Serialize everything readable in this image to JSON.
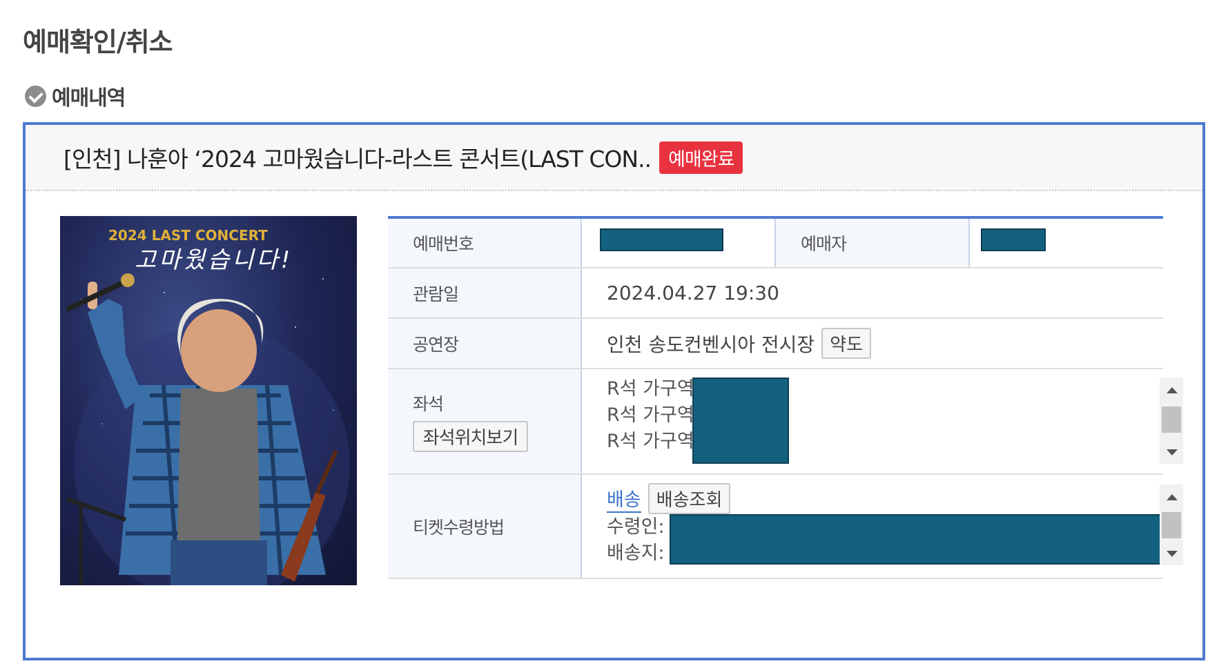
{
  "page_title": "예매확인/취소",
  "section_label": "예매내역",
  "booking": {
    "event_title": "[인천] 나훈아 ‘2024 고마웠습니다-라스트 콘서트(LAST CON..",
    "status": "예매완료",
    "poster": {
      "subtitle": "2024 LAST CONCERT",
      "headline": "고마웠습니다!"
    },
    "fields": {
      "booking_no_label": "예매번호",
      "booker_label": "예매자",
      "date_label": "관람일",
      "date_value": "2024.04.27 19:30",
      "venue_label": "공연장",
      "venue_value": "인천 송도컨벤시아 전시장",
      "map_button": "약도",
      "seat_label": "좌석",
      "seat_button": "좌석위치보기",
      "seats": [
        "R석 가구역",
        "R석 가구역",
        "R석 가구역"
      ],
      "method_label": "티켓수령방법",
      "method_value": "배송",
      "track_button": "배송조회",
      "recipient_label": "수령인: 윤",
      "address_label": "배송지: 1"
    }
  },
  "colors": {
    "accent_border": "#4f7ad1",
    "status_badge": "#e8333f",
    "redaction": "#14607f"
  }
}
